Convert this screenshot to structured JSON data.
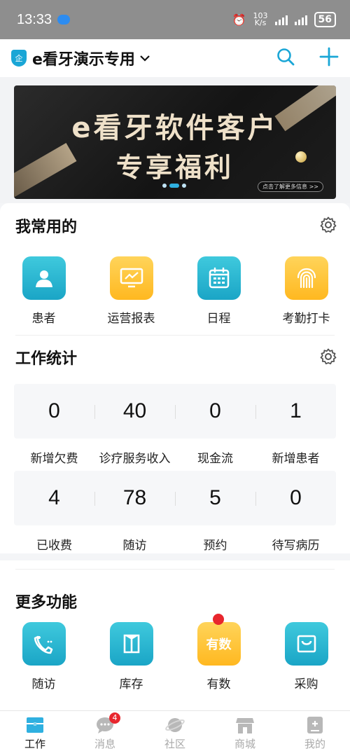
{
  "status_bar": {
    "time": "13:33",
    "net_speed_value": "103",
    "net_speed_unit": "K/s",
    "battery": "56"
  },
  "header": {
    "org_name": "e看牙演示专用",
    "shield_label": "企"
  },
  "banner": {
    "line1": "e看牙软件客户",
    "line2": "专享福利",
    "more": "点击了解更多信息 >>"
  },
  "frequent": {
    "title": "我常用的",
    "items": [
      {
        "label": "患者",
        "icon": "patient-icon"
      },
      {
        "label": "运营报表",
        "icon": "report-icon"
      },
      {
        "label": "日程",
        "icon": "calendar-icon"
      },
      {
        "label": "考勤打卡",
        "icon": "fingerprint-icon"
      }
    ]
  },
  "stats": {
    "title": "工作统计",
    "row1": [
      {
        "value": "0",
        "label": "新增欠费"
      },
      {
        "value": "40",
        "label": "诊疗服务收入"
      },
      {
        "value": "0",
        "label": "现金流"
      },
      {
        "value": "1",
        "label": "新增患者"
      }
    ],
    "row2": [
      {
        "value": "4",
        "label": "已收费"
      },
      {
        "value": "78",
        "label": "随访"
      },
      {
        "value": "5",
        "label": "预约"
      },
      {
        "value": "0",
        "label": "待写病历"
      }
    ]
  },
  "more": {
    "title": "更多功能",
    "items": [
      {
        "label": "随访",
        "icon": "phone-icon"
      },
      {
        "label": "库存",
        "icon": "box-icon"
      },
      {
        "label": "有数",
        "icon": "data-icon",
        "icon_text": "有数"
      },
      {
        "label": "采购",
        "icon": "shopping-bag-icon"
      }
    ]
  },
  "tabbar": {
    "tabs": [
      {
        "label": "工作"
      },
      {
        "label": "消息",
        "badge": "4"
      },
      {
        "label": "社区"
      },
      {
        "label": "商城"
      },
      {
        "label": "我的"
      }
    ]
  },
  "colors": {
    "brand": "#1aa6d6",
    "accent_yellow": "#ffb820",
    "badge_red": "#e8262d"
  }
}
